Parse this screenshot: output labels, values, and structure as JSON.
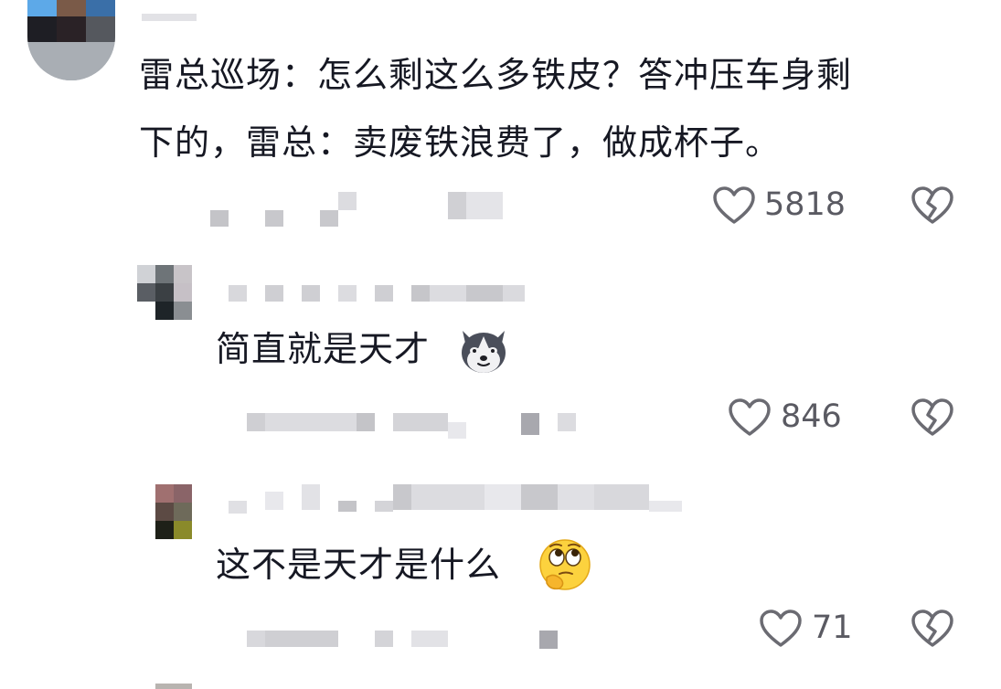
{
  "comments": [
    {
      "text_line1": "雷总巡场：怎么剩这么多铁皮？答冲压车身剩",
      "text_line2": "下的，雷总：卖废铁浪费了，做成杯子。",
      "likes": "5818",
      "like_icon": "heart-outline-icon",
      "dislike_icon": "broken-heart-icon"
    },
    {
      "text": "简直就是天才",
      "emoji": "husky-dog-emoji",
      "likes": "846",
      "like_icon": "heart-outline-icon",
      "dislike_icon": "broken-heart-icon"
    },
    {
      "text": "这不是天才是什么",
      "emoji": "thinking-eye-roll-emoji",
      "likes": "71",
      "like_icon": "heart-outline-icon",
      "dislike_icon": "broken-heart-icon"
    }
  ],
  "colors": {
    "text": "#161823",
    "icon": "#6b6b72",
    "pixelated": "#bdbdc2"
  }
}
